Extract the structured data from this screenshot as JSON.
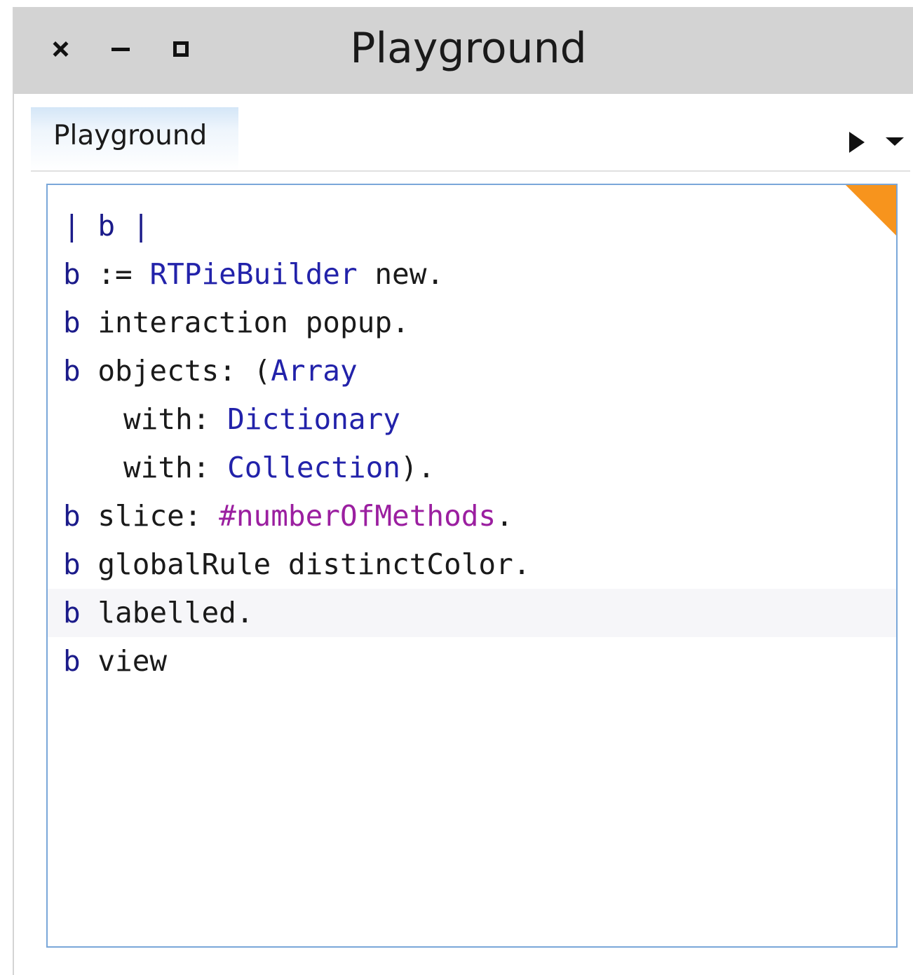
{
  "window": {
    "title": "Playground",
    "controls": {
      "close_icon": "close-icon",
      "minimize_icon": "minimize-icon",
      "maximize_icon": "maximize-icon"
    }
  },
  "tabs": [
    {
      "label": "Playground",
      "active": true
    }
  ],
  "toolbar": {
    "run_icon": "play-icon",
    "menu_icon": "chevron-down-icon"
  },
  "editor": {
    "accent_color": "#f7941d",
    "border_color": "#7aa7d9",
    "highlighted_line_index": 7,
    "lines": [
      {
        "indent": "",
        "tokens": [
          {
            "t": "| ",
            "k": "bar"
          },
          {
            "t": "b",
            "k": "var"
          },
          {
            "t": " |",
            "k": "bar"
          }
        ]
      },
      {
        "indent": "",
        "tokens": [
          {
            "t": "b",
            "k": "var"
          },
          {
            "t": " := ",
            "k": "msg"
          },
          {
            "t": "RTPieBuilder",
            "k": "cls"
          },
          {
            "t": " new.",
            "k": "msg"
          }
        ]
      },
      {
        "indent": "",
        "tokens": [
          {
            "t": "b",
            "k": "var"
          },
          {
            "t": " interaction popup.",
            "k": "msg"
          }
        ]
      },
      {
        "indent": "",
        "tokens": [
          {
            "t": "b",
            "k": "var"
          },
          {
            "t": " objects: (",
            "k": "msg"
          },
          {
            "t": "Array",
            "k": "cls"
          }
        ]
      },
      {
        "indent": " ",
        "tokens": [
          {
            "t": "with: ",
            "k": "msg"
          },
          {
            "t": "Dictionary",
            "k": "cls"
          }
        ]
      },
      {
        "indent": " ",
        "tokens": [
          {
            "t": "with: ",
            "k": "msg"
          },
          {
            "t": "Collection",
            "k": "cls"
          },
          {
            "t": ").",
            "k": "msg"
          }
        ]
      },
      {
        "indent": "",
        "tokens": [
          {
            "t": "b",
            "k": "var"
          },
          {
            "t": " slice: ",
            "k": "msg"
          },
          {
            "t": "#numberOfMethods",
            "k": "sym"
          },
          {
            "t": ".",
            "k": "msg"
          }
        ]
      },
      {
        "indent": "",
        "tokens": [
          {
            "t": "b",
            "k": "var"
          },
          {
            "t": " globalRule distinctColor.",
            "k": "msg"
          }
        ]
      },
      {
        "indent": "",
        "tokens": [
          {
            "t": "b",
            "k": "var"
          },
          {
            "t": " labelled.",
            "k": "msg"
          }
        ]
      },
      {
        "indent": "",
        "tokens": [
          {
            "t": "b",
            "k": "var"
          },
          {
            "t": " view",
            "k": "msg"
          }
        ]
      }
    ]
  }
}
